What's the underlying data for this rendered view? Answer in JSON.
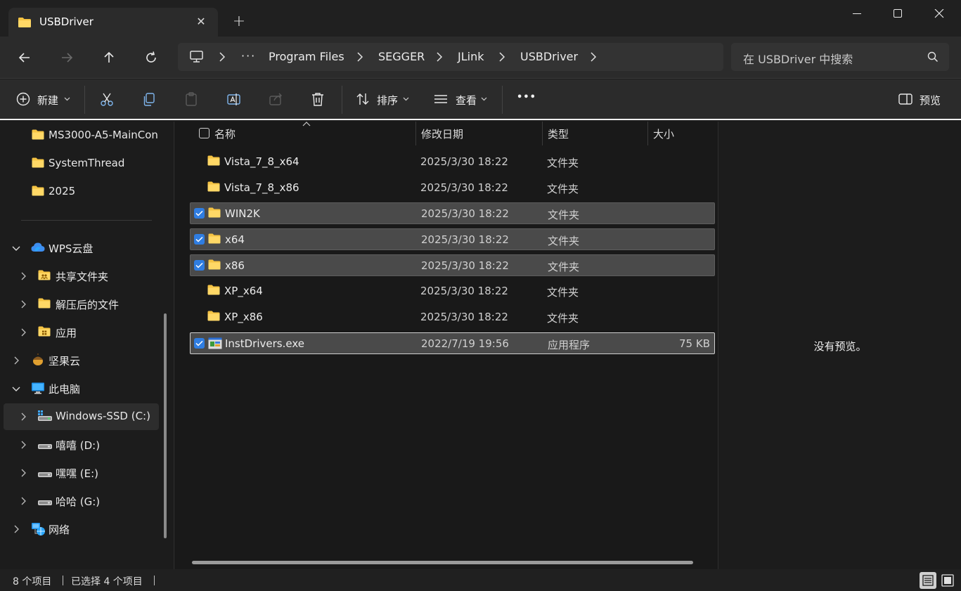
{
  "tab": {
    "title": "USBDriver",
    "close_glyph": "✕",
    "new_tab_glyph": "+"
  },
  "breadcrumb": {
    "overflow": "···",
    "items": [
      "Program Files",
      "SEGGER",
      "JLink",
      "USBDriver"
    ]
  },
  "search": {
    "placeholder": "在 USBDriver 中搜索"
  },
  "toolbar": {
    "new_label": "新建",
    "sort_label": "排序",
    "view_label": "查看",
    "more_glyph": "•••",
    "preview_label": "预览"
  },
  "sidebar": {
    "items": [
      {
        "label": "MS3000-A5-MainCon",
        "icon": "folder-icon"
      },
      {
        "label": "SystemThread",
        "icon": "folder-icon"
      },
      {
        "label": "2025",
        "icon": "folder-icon"
      },
      {
        "label": "WPS云盘",
        "icon": "cloud-icon"
      },
      {
        "label": "共享文件夹",
        "icon": "shared-folder-icon"
      },
      {
        "label": "解压后的文件",
        "icon": "folder-icon"
      },
      {
        "label": "应用",
        "icon": "apps-folder-icon"
      },
      {
        "label": "坚果云",
        "icon": "nut-icon"
      },
      {
        "label": "此电脑",
        "icon": "computer-icon"
      },
      {
        "label": "Windows-SSD (C:)",
        "icon": "drive-icon"
      },
      {
        "label": "嘻嘻 (D:)",
        "icon": "drive-icon"
      },
      {
        "label": "嘿嘿 (E:)",
        "icon": "drive-icon"
      },
      {
        "label": "哈哈 (G:)",
        "icon": "drive-icon"
      },
      {
        "label": "网络",
        "icon": "network-icon"
      }
    ]
  },
  "columns": {
    "name": "名称",
    "modified": "修改日期",
    "type": "类型",
    "size": "大小"
  },
  "files": [
    {
      "name": "Vista_7_8_x64",
      "modified": "2025/3/30 18:22",
      "type": "文件夹",
      "size": "",
      "selected": false
    },
    {
      "name": "Vista_7_8_x86",
      "modified": "2025/3/30 18:22",
      "type": "文件夹",
      "size": "",
      "selected": false
    },
    {
      "name": "WIN2K",
      "modified": "2025/3/30 18:22",
      "type": "文件夹",
      "size": "",
      "selected": true
    },
    {
      "name": "x64",
      "modified": "2025/3/30 18:22",
      "type": "文件夹",
      "size": "",
      "selected": true
    },
    {
      "name": "x86",
      "modified": "2025/3/30 18:22",
      "type": "文件夹",
      "size": "",
      "selected": true
    },
    {
      "name": "XP_x64",
      "modified": "2025/3/30 18:22",
      "type": "文件夹",
      "size": "",
      "selected": false
    },
    {
      "name": "XP_x86",
      "modified": "2025/3/30 18:22",
      "type": "文件夹",
      "size": "",
      "selected": false
    },
    {
      "name": "InstDrivers.exe",
      "modified": "2022/7/19 19:56",
      "type": "应用程序",
      "size": "75 KB",
      "selected": true
    }
  ],
  "preview": {
    "message": "没有预览。"
  },
  "status": {
    "total": "8 个项目",
    "selected": "已选择 4 个项目"
  },
  "colors": {
    "accent": "#2f7de1",
    "folder": "#f5c343",
    "background": "#191919"
  }
}
